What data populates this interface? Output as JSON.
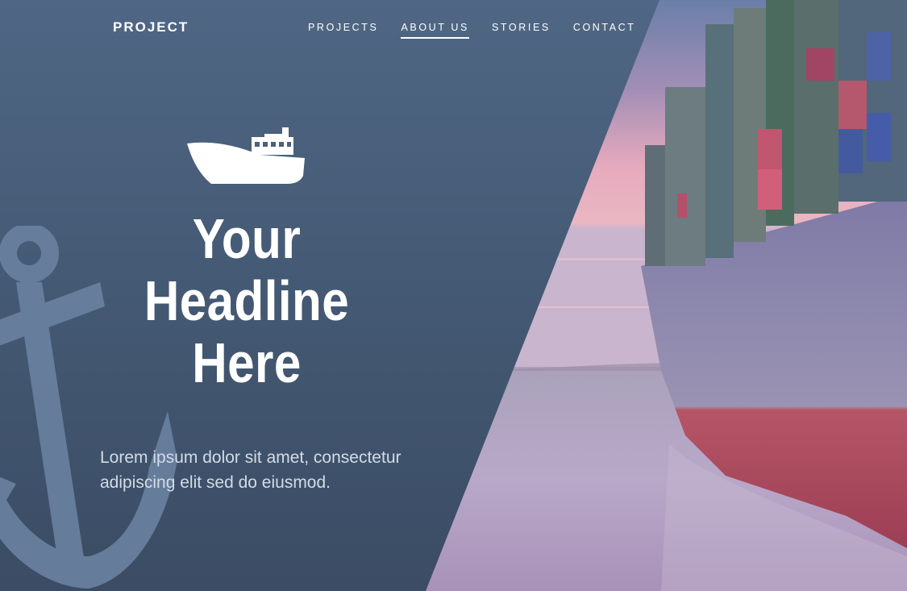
{
  "brand": {
    "name": "PROJECT"
  },
  "nav": {
    "items": [
      {
        "label": "PROJECTS"
      },
      {
        "label": "ABOUT US"
      },
      {
        "label": "STORIES"
      },
      {
        "label": "CONTACT"
      }
    ],
    "active": "ABOUT US"
  },
  "hero": {
    "headline_lines": [
      "Your",
      "Headline",
      "Here"
    ],
    "lead_line1": "Lorem ipsum dolor sit amet, consectetur",
    "lead_line2": "adipiscing elit sed do eiusmod."
  },
  "icons": {
    "hero": "ship-icon",
    "background": "anchor-icon"
  },
  "colors": {
    "panel": "#455a75",
    "text": "#ffffff",
    "lead_text": "#d4dbe5",
    "anchor": "#6a82a0",
    "hull_red": "#b3505f",
    "hull_gray": "#8f8ba8",
    "sky_pink": "#e7aabd",
    "water": "#b6a6c4"
  }
}
